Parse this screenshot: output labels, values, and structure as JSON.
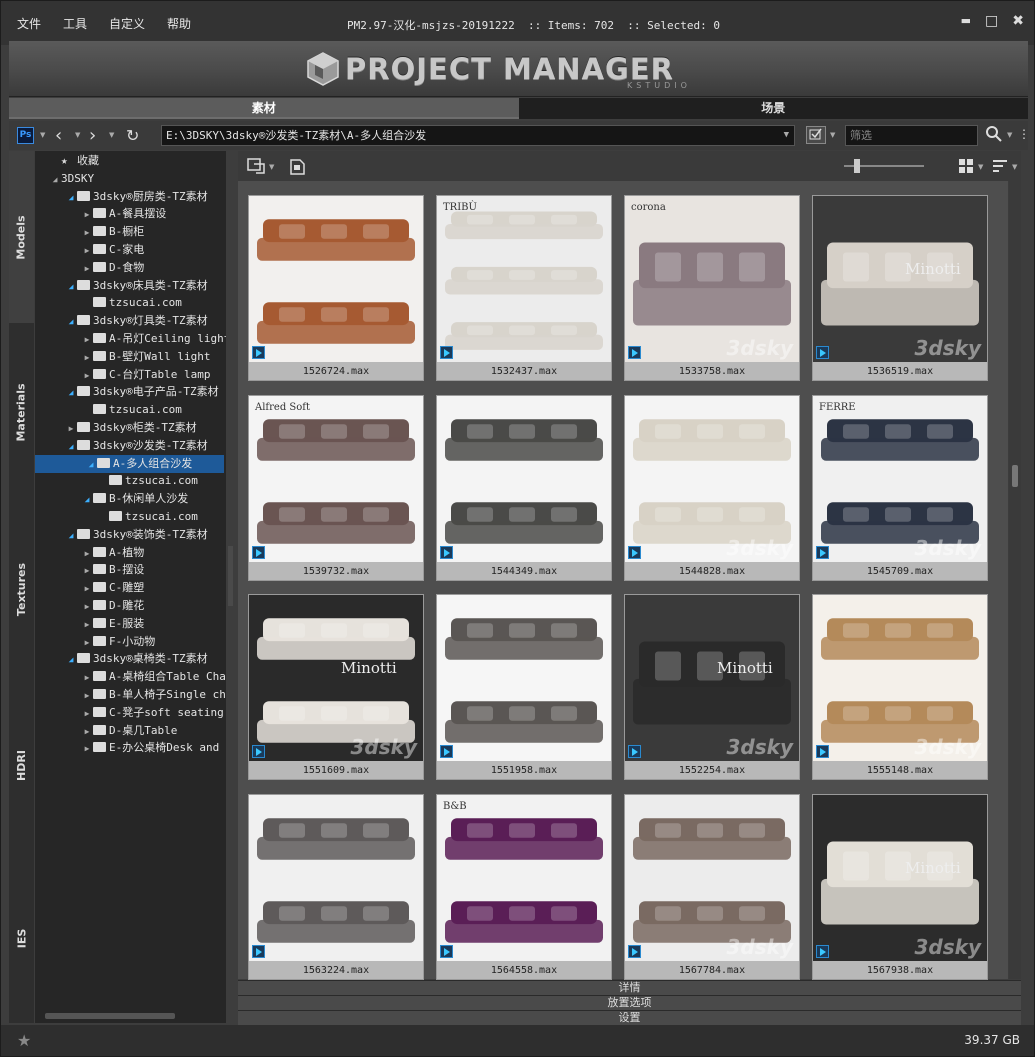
{
  "menu": [
    "文件",
    "工具",
    "自定义",
    "帮助"
  ],
  "title": "PM2.97-汉化-msjzs-20191222  :: Items: 702  :: Selected: 0",
  "window_buttons": {
    "minimize": "▬",
    "maximize": "□",
    "close": "✖"
  },
  "banner": {
    "logo_text": "PROJECT MANAGER",
    "logo_sub": "KSTUDIO"
  },
  "tabs": [
    {
      "label": "素材",
      "active": true
    },
    {
      "label": "场景",
      "active": false
    }
  ],
  "toolbar": {
    "ps_label": "Ps",
    "path": "E:\\3DSKY\\3dsky®沙发类-TZ素材\\A-多人组合沙发",
    "filter_placeholder": "筛选"
  },
  "side_tabs": [
    "Models",
    "Materials",
    "Textures",
    "HDRI",
    "IES"
  ],
  "tree": [
    {
      "label": "收藏",
      "level": 0,
      "kind": "fav",
      "arrow": "none"
    },
    {
      "label": "3DSKY",
      "level": 0,
      "kind": "text",
      "arrow": "expanded-gray"
    },
    {
      "label": "3dsky®厨房类-TZ素材",
      "level": 1,
      "kind": "folder",
      "arrow": "expanded"
    },
    {
      "label": "A-餐具摆设",
      "level": 2,
      "kind": "folder",
      "arrow": "collapsed"
    },
    {
      "label": "B-橱柜",
      "level": 2,
      "kind": "folder",
      "arrow": "collapsed"
    },
    {
      "label": "C-家电",
      "level": 2,
      "kind": "folder",
      "arrow": "collapsed"
    },
    {
      "label": "D-食物",
      "level": 2,
      "kind": "folder",
      "arrow": "collapsed"
    },
    {
      "label": "3dsky®床具类-TZ素材",
      "level": 1,
      "kind": "folder",
      "arrow": "expanded"
    },
    {
      "label": "tzsucai.com",
      "level": 2,
      "kind": "folder",
      "arrow": "none"
    },
    {
      "label": "3dsky®灯具类-TZ素材",
      "level": 1,
      "kind": "folder",
      "arrow": "expanded"
    },
    {
      "label": "A-吊灯Ceiling light",
      "level": 2,
      "kind": "folder",
      "arrow": "collapsed"
    },
    {
      "label": "B-壁灯Wall light",
      "level": 2,
      "kind": "folder",
      "arrow": "collapsed"
    },
    {
      "label": "C-台灯Table lamp",
      "level": 2,
      "kind": "folder",
      "arrow": "collapsed"
    },
    {
      "label": "3dsky®电子产品-TZ素材",
      "level": 1,
      "kind": "folder",
      "arrow": "expanded"
    },
    {
      "label": "tzsucai.com",
      "level": 2,
      "kind": "folder",
      "arrow": "none"
    },
    {
      "label": "3dsky®柜类-TZ素材",
      "level": 1,
      "kind": "folder",
      "arrow": "collapsed"
    },
    {
      "label": "3dsky®沙发类-TZ素材",
      "level": 1,
      "kind": "folder",
      "arrow": "expanded"
    },
    {
      "label": "A-多人组合沙发",
      "level": 2,
      "kind": "folder",
      "arrow": "expanded",
      "selected": true
    },
    {
      "label": "tzsucai.com",
      "level": 3,
      "kind": "folder",
      "arrow": "none"
    },
    {
      "label": "B-休闲单人沙发",
      "level": 2,
      "kind": "folder",
      "arrow": "expanded"
    },
    {
      "label": "tzsucai.com",
      "level": 3,
      "kind": "folder",
      "arrow": "none"
    },
    {
      "label": "3dsky®装饰类-TZ素材",
      "level": 1,
      "kind": "folder",
      "arrow": "expanded"
    },
    {
      "label": "A-植物",
      "level": 2,
      "kind": "folder",
      "arrow": "collapsed"
    },
    {
      "label": "B-摆设",
      "level": 2,
      "kind": "folder",
      "arrow": "collapsed"
    },
    {
      "label": "C-雕塑",
      "level": 2,
      "kind": "folder",
      "arrow": "collapsed"
    },
    {
      "label": "D-雕花",
      "level": 2,
      "kind": "folder",
      "arrow": "collapsed"
    },
    {
      "label": "E-服装",
      "level": 2,
      "kind": "folder",
      "arrow": "collapsed"
    },
    {
      "label": "F-小动物",
      "level": 2,
      "kind": "folder",
      "arrow": "collapsed"
    },
    {
      "label": "3dsky®桌椅类-TZ素材",
      "level": 1,
      "kind": "folder",
      "arrow": "expanded"
    },
    {
      "label": "A-桌椅组合Table Chair",
      "level": 2,
      "kind": "folder",
      "arrow": "collapsed"
    },
    {
      "label": "B-单人椅子Single chair",
      "level": 2,
      "kind": "folder",
      "arrow": "collapsed"
    },
    {
      "label": "C-凳子soft seating",
      "level": 2,
      "kind": "folder",
      "arrow": "collapsed"
    },
    {
      "label": "D-桌几Table",
      "level": 2,
      "kind": "folder",
      "arrow": "collapsed"
    },
    {
      "label": "E-办公桌椅Desk and chair",
      "level": 2,
      "kind": "folder",
      "arrow": "collapsed"
    }
  ],
  "items": [
    {
      "name": "1526724.max",
      "bg": "#f2f0ee",
      "sofa": "#a65a32",
      "rows": 2,
      "text": "",
      "wm": ""
    },
    {
      "name": "1532437.max",
      "bg": "#ececec",
      "sofa": "#d8d4cc",
      "rows": 3,
      "text": "TRIBÙ",
      "wm": ""
    },
    {
      "name": "1533758.max",
      "bg": "#e8e4e0",
      "sofa": "#8a7a80",
      "rows": 1,
      "text": "corona",
      "wm": "3dsky"
    },
    {
      "name": "1536519.max",
      "bg": "#3a3a3a",
      "sofa": "#d6d0c8",
      "rows": 1,
      "text": "Minotti",
      "wm": "3dsky"
    },
    {
      "name": "1539732.max",
      "bg": "#f4f4f4",
      "sofa": "#6a5552",
      "rows": 2,
      "text": "Alfred Soft",
      "wm": ""
    },
    {
      "name": "1544349.max",
      "bg": "#f4f4f4",
      "sofa": "#4a4a48",
      "rows": 2,
      "text": "",
      "wm": ""
    },
    {
      "name": "1544828.max",
      "bg": "#f4f4f4",
      "sofa": "#d8d2c6",
      "rows": 2,
      "text": "",
      "wm": "3dsky"
    },
    {
      "name": "1545709.max",
      "bg": "#f0f0f0",
      "sofa": "#2c3444",
      "rows": 2,
      "text": "FERRE",
      "wm": "3dsky"
    },
    {
      "name": "1551609.max",
      "bg": "#2a2a2a",
      "sofa": "#e6e2dc",
      "rows": 2,
      "text": "Minotti",
      "wm": "3dsky"
    },
    {
      "name": "1551958.max",
      "bg": "#f6f6f6",
      "sofa": "#5a5654",
      "rows": 2,
      "text": "",
      "wm": ""
    },
    {
      "name": "1552254.max",
      "bg": "#3a3a3a",
      "sofa": "#2a2a2a",
      "rows": 1,
      "text": "Minotti",
      "wm": "3dsky"
    },
    {
      "name": "1555148.max",
      "bg": "#f4f0ea",
      "sofa": "#b48a5a",
      "rows": 2,
      "text": "",
      "wm": "3dsky"
    },
    {
      "name": "1563224.max",
      "bg": "#f0f0f0",
      "sofa": "#5e5a5a",
      "rows": 2,
      "text": "",
      "wm": ""
    },
    {
      "name": "1564558.max",
      "bg": "#f2f2f2",
      "sofa": "#5a1e56",
      "rows": 2,
      "text": "B&B",
      "wm": ""
    },
    {
      "name": "1567784.max",
      "bg": "#ececec",
      "sofa": "#7a6a62",
      "rows": 2,
      "text": "",
      "wm": "3dsky"
    },
    {
      "name": "1567938.max",
      "bg": "#2c2c2c",
      "sofa": "#e2ded6",
      "rows": 1,
      "text": "Minotti",
      "wm": "3dsky"
    }
  ],
  "panels": [
    "详情",
    "放置选项",
    "设置"
  ],
  "status": {
    "disk": "39.37 GB"
  },
  "colors": {
    "accent": "#1e5a99",
    "arrow_expanded": "#3cb0ff",
    "badge": "#3ac8ff"
  }
}
